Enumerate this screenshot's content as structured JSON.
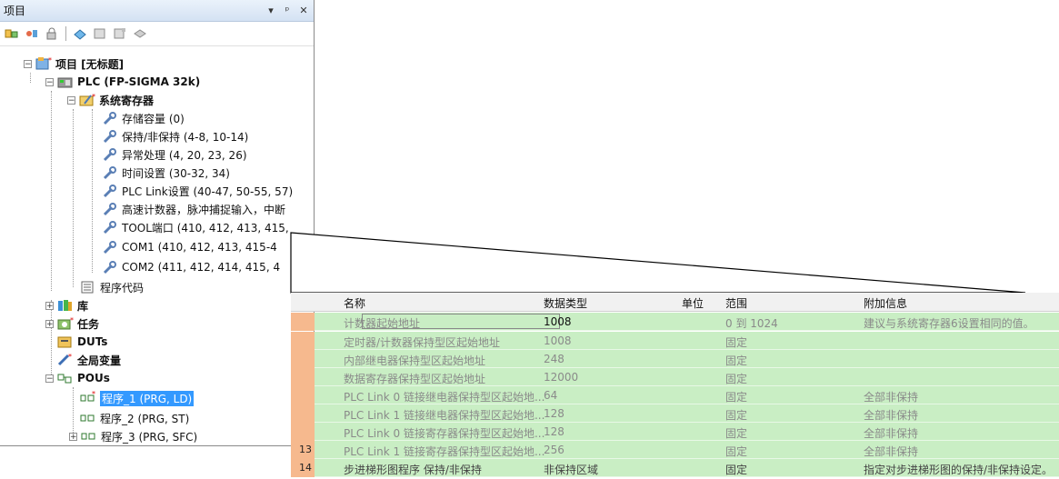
{
  "panel": {
    "title": "项目",
    "controls": [
      "▾",
      "ᵖ",
      "✕"
    ],
    "toolbar_icons": [
      "tree-expand-icon",
      "tree-filter-icon",
      "tree-lock-icon",
      "compile-icon",
      "book-icon",
      "book-edit-icon",
      "disk-icon"
    ]
  },
  "tree": {
    "project": "项目 [无标题]",
    "plc": "PLC (FP-SIGMA 32k)",
    "sysreg": "系统寄存器",
    "sysreg_items": [
      "存储容量 (0)",
      "保持/非保持 (4-8, 10-14)",
      "异常处理 (4, 20, 23, 26)",
      "时间设置 (30-32, 34)",
      "PLC Link设置 (40-47, 50-55, 57)",
      "高速计数器，脉冲捕捉输入，中断",
      "TOOL端口 (410, 412, 413, 415,",
      "COM1 (410, 412, 413, 415-4",
      "COM2 (411, 412, 414, 415, 4"
    ],
    "program_code": "程序代码",
    "library": "库",
    "tasks": "任务",
    "duts": "DUTs",
    "globals": "全局变量",
    "pous": "POUs",
    "pou_items": [
      "程序_1 (PRG, LD)",
      "程序_2 (PRG, ST)",
      "程序_3 (PRG, SFC)"
    ]
  },
  "table": {
    "headers": {
      "name": "名称",
      "type": "数据类型",
      "unit": "单位",
      "range": "范围",
      "info": "附加信息"
    },
    "rows": [
      {
        "num": "",
        "name": "计数器起始地址",
        "type": "1008",
        "range": "0 到 1024",
        "info": "建议与系统寄存器6设置相同的值。"
      },
      {
        "num": "",
        "name": "定时器/计数器保持型区起始地址",
        "type": "1008",
        "range": "固定",
        "info": ""
      },
      {
        "num": "",
        "name": "内部继电器保持型区起始地址",
        "type": "248",
        "range": "固定",
        "info": ""
      },
      {
        "num": "",
        "name": "数据寄存器保持型区起始地址",
        "type": "12000",
        "range": "固定",
        "info": ""
      },
      {
        "num": "",
        "name": "PLC Link 0 链接继电器保持型区起始地...",
        "type": "64",
        "range": "固定",
        "info": "全部非保持"
      },
      {
        "num": "",
        "name": "PLC Link 1 链接继电器保持型区起始地...",
        "type": "128",
        "range": "固定",
        "info": "全部非保持"
      },
      {
        "num": "",
        "name": "PLC Link 0 链接寄存器保持型区起始地...",
        "type": "128",
        "range": "固定",
        "info": "全部非保持"
      },
      {
        "num": "13",
        "name": "PLC Link 1 链接寄存器保持型区起始地...",
        "type": "256",
        "range": "固定",
        "info": "全部非保持"
      },
      {
        "num": "14",
        "name": "步进梯形图程序 保持/非保持",
        "type": "非保持区域",
        "range": "固定",
        "info": "指定对步进梯形图的保持/非保持设定。"
      }
    ]
  }
}
